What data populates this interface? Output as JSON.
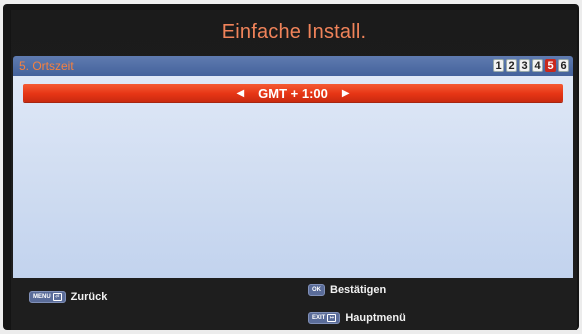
{
  "window": {
    "title": "Einfache Install."
  },
  "step": {
    "label": "5. Ortszeit",
    "numbers": [
      "1",
      "2",
      "3",
      "4",
      "5",
      "6"
    ],
    "active_index": 4
  },
  "timezone": {
    "value": "GMT + 1:00",
    "left_arrow": "◀",
    "right_arrow": "▶"
  },
  "footer": {
    "back": {
      "key": "MENU",
      "label": "Zurück"
    },
    "confirm": {
      "key": "OK",
      "label": "Bestätigen"
    },
    "main_menu": {
      "key": "EXIT",
      "label": "Hauptmenü"
    }
  },
  "colors": {
    "accent": "#e63515",
    "title": "#f0835a",
    "step_bar": "#4f6ca4",
    "panel": "#d4e0f3"
  }
}
